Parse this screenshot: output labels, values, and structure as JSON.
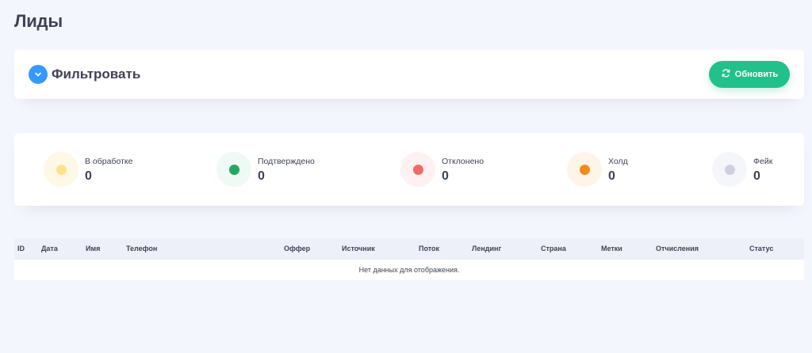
{
  "page": {
    "title": "Лиды"
  },
  "filter": {
    "label": "Фильтровать",
    "refresh_label": "Обновить",
    "accent_color": "#3699ff",
    "refresh_color": "#22c08a"
  },
  "stats": [
    {
      "label": "В обработке",
      "value": "0",
      "color": "#ffe38a",
      "bg": "#fff8e6",
      "icon": "pending-dot-icon"
    },
    {
      "label": "Подтверждено",
      "value": "0",
      "color": "#22a85f",
      "bg": "#eefaf3",
      "icon": "confirmed-dot-icon"
    },
    {
      "label": "Отклонено",
      "value": "0",
      "color": "#f06a6a",
      "bg": "#fff1f1",
      "icon": "rejected-dot-icon"
    },
    {
      "label": "Холд",
      "value": "0",
      "color": "#f48a1d",
      "bg": "#fff4e8",
      "icon": "hold-dot-icon"
    },
    {
      "label": "Фейк",
      "value": "0",
      "color": "#cdd1de",
      "bg": "#f5f6fb",
      "icon": "fake-dot-icon"
    }
  ],
  "table": {
    "columns": [
      "ID",
      "Дата",
      "Имя",
      "Телефон",
      "Оффер",
      "Источник",
      "Поток",
      "Лендинг",
      "Страна",
      "Метки",
      "Отчисления",
      "Статус"
    ],
    "empty_text": "Нет данных для отображения."
  }
}
